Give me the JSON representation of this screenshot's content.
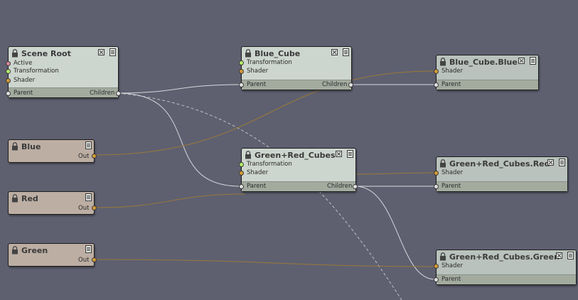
{
  "nodes": {
    "scene_root": {
      "title": "Scene Root",
      "ports": {
        "active": "Active",
        "transformation": "Transformation",
        "shader": "Shader",
        "parent": "Parent",
        "children": "Children"
      }
    },
    "blue_cube": {
      "title": "Blue_Cube",
      "ports": {
        "transformation": "Transformation",
        "shader": "Shader",
        "parent": "Parent",
        "children": "Children"
      }
    },
    "blue_cube_blue": {
      "title": "Blue_Cube.Blue",
      "ports": {
        "shader": "Shader",
        "parent": "Parent"
      }
    },
    "blue": {
      "title": "Blue",
      "ports": {
        "out": "Out"
      }
    },
    "red": {
      "title": "Red",
      "ports": {
        "out": "Out"
      }
    },
    "green": {
      "title": "Green",
      "ports": {
        "out": "Out"
      }
    },
    "green_red_cubes": {
      "title": "Green+Red_Cubes",
      "ports": {
        "transformation": "Transformation",
        "shader": "Shader",
        "parent": "Parent",
        "children": "Children"
      }
    },
    "green_red_cubes_red": {
      "title": "Green+Red_Cubes.Red",
      "ports": {
        "shader": "Shader",
        "parent": "Parent"
      }
    },
    "green_red_cubes_green": {
      "title": "Green+Red_Cubes.Green",
      "ports": {
        "shader": "Shader",
        "parent": "Parent"
      }
    }
  },
  "colors": {
    "background": "#5e6070",
    "hierarchy_wire": "#d6d8dc",
    "shader_wire": "#9a7838",
    "dashed_wire": "#d6d8dc"
  }
}
